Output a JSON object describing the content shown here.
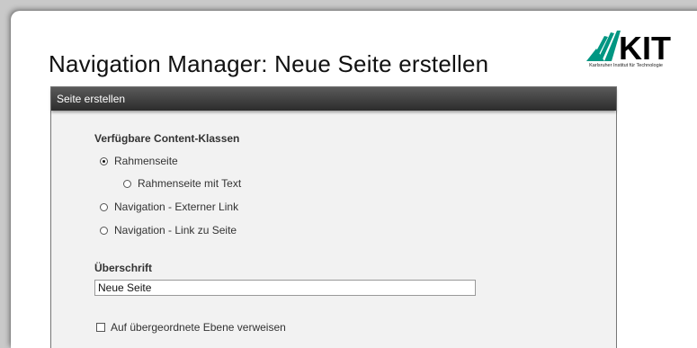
{
  "page": {
    "title": "Navigation Manager: Neue Seite erstellen"
  },
  "logo": {
    "text": "KIT",
    "tagline": "Karlsruher Institut für Technologie",
    "color": "#009682"
  },
  "panel": {
    "header": "Seite erstellen",
    "content_classes": {
      "label": "Verfügbare Content-Klassen",
      "options": [
        {
          "label": "Rahmenseite",
          "checked": true
        },
        {
          "label": "Rahmenseite mit Text",
          "checked": false
        },
        {
          "label": "Navigation - Externer Link",
          "checked": false
        },
        {
          "label": "Navigation - Link zu Seite",
          "checked": false
        }
      ]
    },
    "heading": {
      "label": "Überschrift",
      "value": "Neue Seite"
    },
    "parent_ref": {
      "label": "Auf übergeordnete Ebene verweisen",
      "checked": false
    }
  }
}
